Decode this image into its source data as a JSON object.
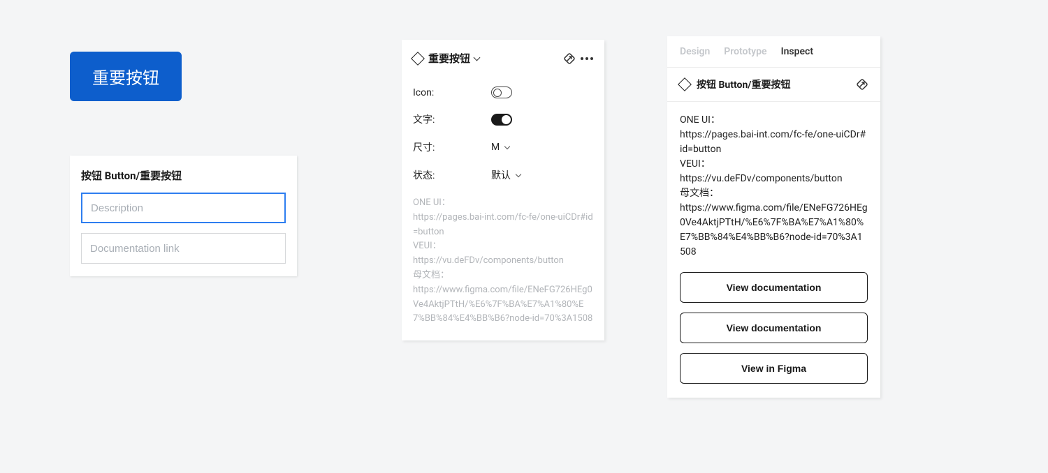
{
  "main_button": {
    "label": "重要按钮"
  },
  "form_card": {
    "title": "按钮 Button/重要按钮",
    "description_placeholder": "Description",
    "doclink_placeholder": "Documentation link"
  },
  "props_panel": {
    "title": "重要按钮",
    "rows": {
      "icon": {
        "label": "Icon:",
        "value": "off"
      },
      "text": {
        "label": "文字:",
        "value": "on"
      },
      "size": {
        "label": "尺寸:",
        "value": "M"
      },
      "status": {
        "label": "状态:",
        "value": "默认"
      }
    },
    "description": "ONE UI：\nhttps://pages.bai-int.com/fc-fe/one-uiCDr#id=button\nVEUI：\nhttps://vu.deFDv/components/button\n母文档：\nhttps://www.figma.com/file/ENeFG726HEg0Ve4AktjPTtH/%E6%7F%BA%E7%A1%80%E7%BB%84%E4%BB%B6?node-id=70%3A1508"
  },
  "inspect_panel": {
    "tabs": {
      "design": "Design",
      "prototype": "Prototype",
      "inspect": "Inspect"
    },
    "title": "按钮 Button/重要按钮",
    "description": "ONE UI：\nhttps://pages.bai-int.com/fc-fe/one-uiCDr#id=button\nVEUI：\nhttps://vu.deFDv/components/button\n母文档：\nhttps://www.figma.com/file/ENeFG726HEg0Ve4AktjPTtH/%E6%7F%BA%E7%A1%80%E7%BB%84%E4%BB%B6?node-id=70%3A1508",
    "buttons": {
      "doc1": "View documentation",
      "doc2": "View documentation",
      "figma": "View in Figma"
    }
  }
}
